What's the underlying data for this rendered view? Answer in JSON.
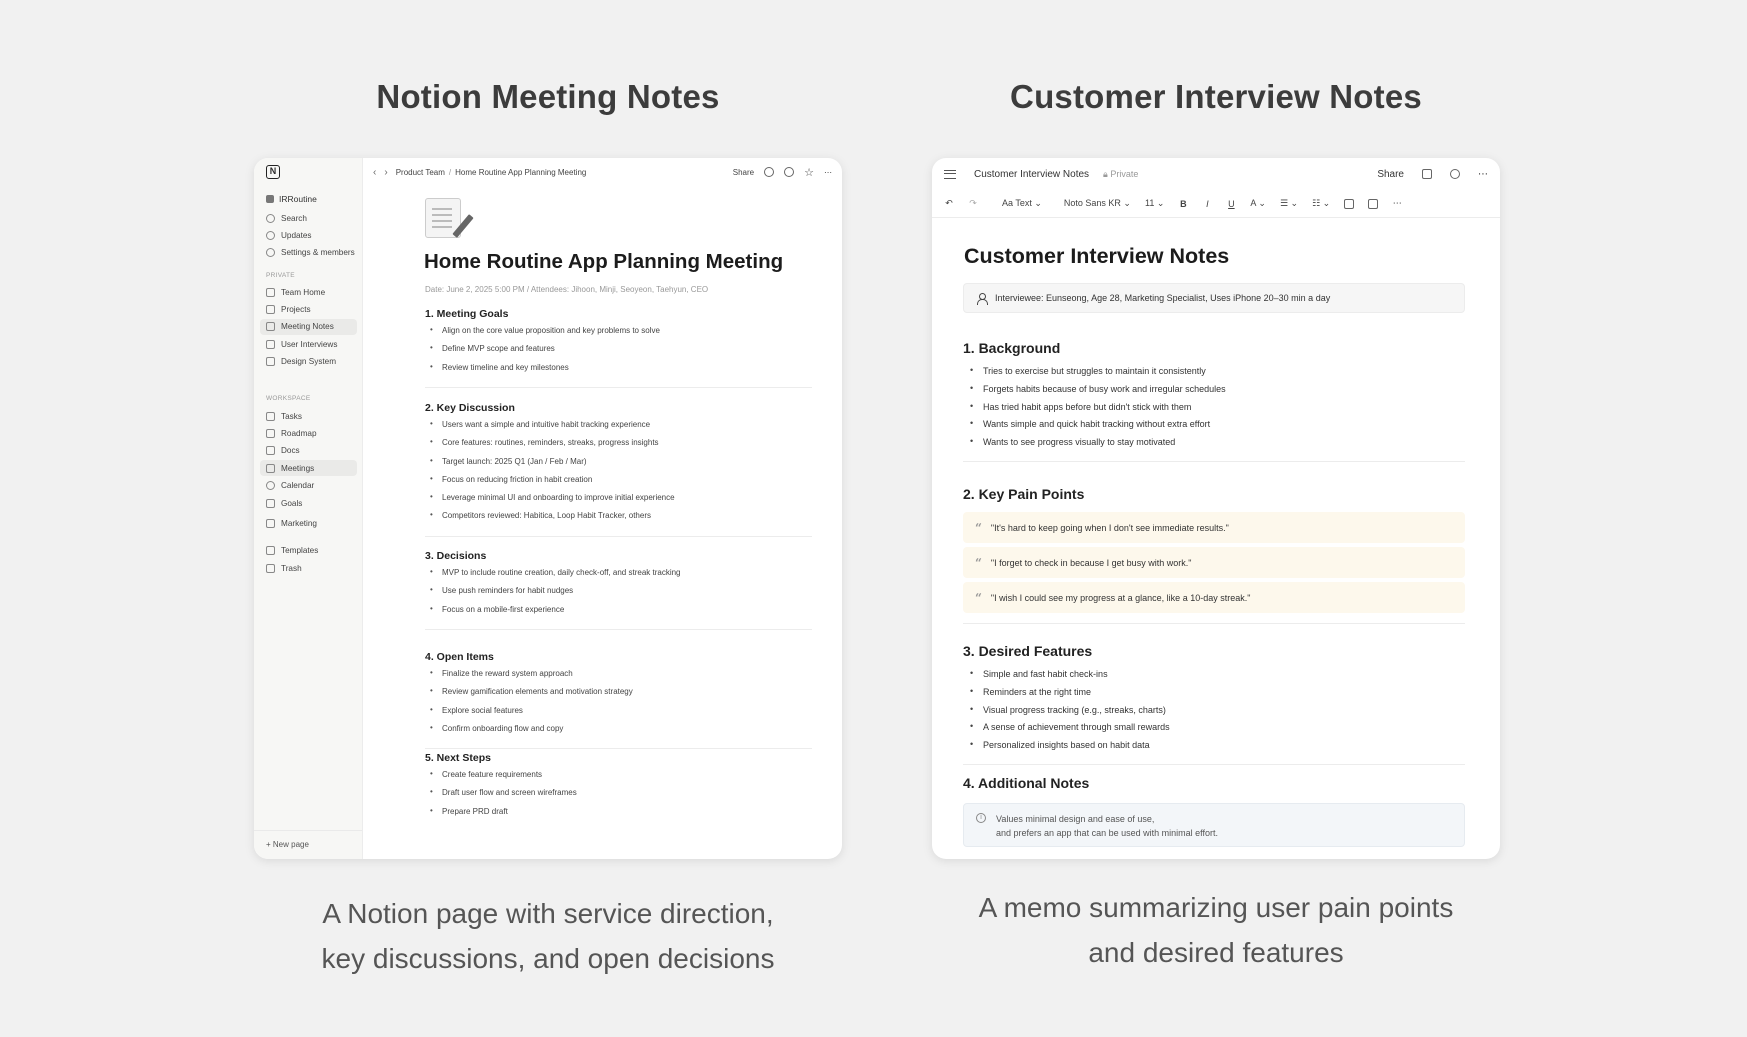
{
  "left_panel": {
    "title": "Notion Meeting Notes",
    "caption_line1": "A Notion page with service direction,",
    "caption_line2": "key discussions, and open decisions"
  },
  "right_panel": {
    "title": "Customer Interview Notes",
    "caption_line1": "A memo summarizing user pain points",
    "caption_line2": "and desired features"
  },
  "notion": {
    "logo": "N",
    "workspace": "IRRoutine",
    "top_items": [
      {
        "label": "Search",
        "icon": "search-icon"
      },
      {
        "label": "Updates",
        "icon": "clock-icon"
      },
      {
        "label": "Settings & members",
        "icon": "gear-icon"
      }
    ],
    "private_label": "PRIVATE",
    "private_items": [
      {
        "label": "Team Home",
        "icon": "home-icon"
      },
      {
        "label": "Projects",
        "icon": "folder-icon"
      },
      {
        "label": "Meeting Notes",
        "icon": "notes-icon",
        "active": true
      },
      {
        "label": "User Interviews",
        "icon": "users-icon"
      },
      {
        "label": "Design System",
        "icon": "grid-icon"
      }
    ],
    "workspace_label": "WORKSPACE",
    "workspace_items": [
      {
        "label": "Tasks",
        "icon": "check-icon"
      },
      {
        "label": "Roadmap",
        "icon": "map-icon"
      },
      {
        "label": "Docs",
        "icon": "doc-icon"
      },
      {
        "label": "Meetings",
        "icon": "meetings-icon",
        "active": true
      },
      {
        "label": "Calendar",
        "icon": "calendar-icon"
      },
      {
        "label": "Goals",
        "icon": "goal-icon"
      },
      {
        "label": "Marketing",
        "icon": "megaphone-icon"
      }
    ],
    "bottom_items": [
      {
        "label": "Templates",
        "icon": "template-icon"
      },
      {
        "label": "Trash",
        "icon": "trash-icon"
      }
    ],
    "new_page": "+ New page",
    "breadcrumb_1": "Product Team",
    "breadcrumb_sep": "/",
    "breadcrumb_2": "Home Routine App Planning Meeting",
    "share": "Share",
    "page_title": "Home Routine App Planning Meeting",
    "meta": "Date: June 2, 2025 5:00 PM  /  Attendees: Jihoon, Minji, Seoyeon, Taehyun, CEO",
    "sections": [
      {
        "heading": "1. Meeting Goals",
        "items": [
          "Align on the core value proposition and key problems to solve",
          "Define MVP scope and features",
          "Review timeline and key milestones"
        ]
      },
      {
        "heading": "2. Key Discussion",
        "items": [
          "Users want a simple and intuitive habit tracking experience",
          "Core features: routines, reminders, streaks, progress insights",
          "Target launch: 2025 Q1 (Jan / Feb / Mar)",
          "Focus on reducing friction in habit creation",
          "Leverage minimal UI and onboarding to improve initial experience",
          "Competitors reviewed: Habitica, Loop Habit Tracker, others"
        ]
      },
      {
        "heading": "3. Decisions",
        "items": [
          "MVP to include routine creation, daily check-off, and streak tracking",
          "Use push reminders for habit nudges",
          "Focus on a mobile-first experience"
        ]
      },
      {
        "heading": "4. Open Items",
        "items": [
          "Finalize the reward system approach",
          "Review gamification elements and motivation strategy",
          "Explore social features",
          "Confirm onboarding flow and copy"
        ]
      },
      {
        "heading": "5. Next Steps",
        "items": [
          "Create feature requirements",
          "Draft user flow and screen wireframes",
          "Prepare PRD draft"
        ]
      }
    ]
  },
  "interview": {
    "doc_name": "Customer Interview Notes",
    "private": "Private",
    "share": "Share",
    "toolbar": {
      "undo": "↶",
      "redo": "↷",
      "style": "Aa Text ⌄",
      "font": "Noto Sans KR ⌄",
      "size": "11 ⌄",
      "bold": "B",
      "italic": "I",
      "underline": "U",
      "color": "A ⌄",
      "bullets": "☰ ⌄",
      "numbers": "☷ ⌄",
      "more": "⋯"
    },
    "title": "Customer Interview Notes",
    "interviewee": "Interviewee: Eunseong, Age 28, Marketing Specialist, Uses iPhone 20–30 min a day",
    "background_heading": "1. Background",
    "background_items": [
      "Tries to exercise but struggles to maintain it consistently",
      "Forgets habits because of busy work and irregular schedules",
      "Has tried habit apps before but didn't stick with them",
      "Wants simple and quick habit tracking without extra effort",
      "Wants to see progress visually to stay motivated"
    ],
    "pain_heading": "2. Key Pain Points",
    "quotes": [
      "\"It's hard to keep going when I don't see immediate results.\"",
      "\"I forget to check in because I get busy with work.\"",
      "\"I wish I could see my progress at a glance, like a 10-day streak.\""
    ],
    "features_heading": "3. Desired Features",
    "features_items": [
      "Simple and fast habit check-ins",
      "Reminders at the right time",
      "Visual progress tracking (e.g., streaks, charts)",
      "A sense of achievement through small rewards",
      "Personalized insights based on habit data"
    ],
    "notes_heading": "4. Additional Notes",
    "note_line1": "Values minimal design and ease of use,",
    "note_line2": "and prefers an app that can be used with minimal effort."
  }
}
